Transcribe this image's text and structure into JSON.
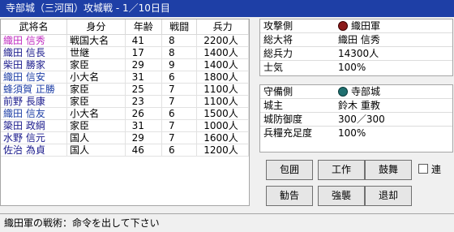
{
  "window": {
    "title": "寺部城（三河国）攻城戦 - 1／10日目"
  },
  "officers": {
    "headers": [
      "武将名",
      "身分",
      "年齢",
      "戦闘",
      "兵力"
    ],
    "rows": [
      {
        "name": "織田 信秀",
        "rank": "戦国大名",
        "age": "41",
        "combat": "8",
        "troops": "2200人",
        "kind": "general"
      },
      {
        "name": "織田 信長",
        "rank": "世継",
        "age": "17",
        "combat": "8",
        "troops": "1400人",
        "kind": "officer"
      },
      {
        "name": "柴田 勝家",
        "rank": "家臣",
        "age": "29",
        "combat": "9",
        "troops": "1400人",
        "kind": "officer"
      },
      {
        "name": "織田 信安",
        "rank": "小大名",
        "age": "31",
        "combat": "6",
        "troops": "1800人",
        "kind": "enemy"
      },
      {
        "name": "蜂須賀 正勝",
        "rank": "家臣",
        "age": "25",
        "combat": "7",
        "troops": "1100人",
        "kind": "enemy"
      },
      {
        "name": "前野 長康",
        "rank": "家臣",
        "age": "23",
        "combat": "7",
        "troops": "1100人",
        "kind": "officer"
      },
      {
        "name": "織田 信友",
        "rank": "小大名",
        "age": "26",
        "combat": "6",
        "troops": "1500人",
        "kind": "enemy"
      },
      {
        "name": "簗田 政綱",
        "rank": "家臣",
        "age": "31",
        "combat": "7",
        "troops": "1000人",
        "kind": "officer"
      },
      {
        "name": "水野 信元",
        "rank": "国人",
        "age": "29",
        "combat": "7",
        "troops": "1600人",
        "kind": "officer"
      },
      {
        "name": "佐治 為貞",
        "rank": "国人",
        "age": "46",
        "combat": "6",
        "troops": "1200人",
        "kind": "officer"
      }
    ]
  },
  "attack": {
    "side_label": "攻撃側",
    "clan": "織田軍",
    "clan_icon": "oda-crest-icon",
    "general_label": "総大将",
    "general": "織田 信秀",
    "troops_label": "総兵力",
    "troops": "14300人",
    "morale_label": "士気",
    "morale": "100%"
  },
  "defend": {
    "side_label": "守備側",
    "clan": "寺部城",
    "clan_icon": "terabe-crest-icon",
    "lord_label": "城主",
    "lord": "鈴木 重教",
    "defense_label": "城防御度",
    "defense": "300／300",
    "supply_label": "兵糧充足度",
    "supply": "100%"
  },
  "commands": {
    "siege": "包囲",
    "sabotage": "工作",
    "rally": "鼓舞",
    "advise": "勧告",
    "assault": "強襲",
    "retreat": "退却",
    "repeat": "連"
  },
  "status": {
    "message": "織田軍の戦術：命令を出して下さい"
  },
  "colors": {
    "titlebar": "#1e3fa6",
    "general_name": "#c02cc0",
    "enemy_name": "#1e3fa6"
  }
}
